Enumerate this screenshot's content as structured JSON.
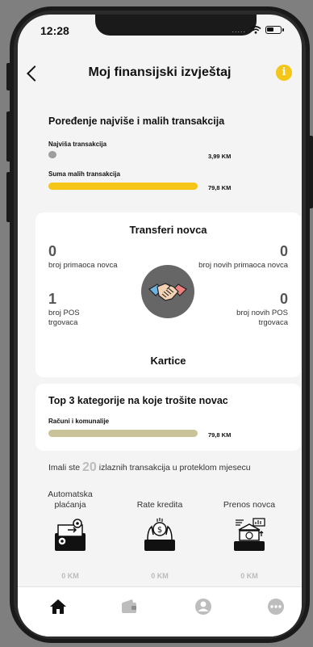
{
  "status_bar": {
    "time": "12:28",
    "dots": "....."
  },
  "header": {
    "title": "Moj finansijski izvještaj",
    "info_glyph": "i"
  },
  "comparison": {
    "title": "Poređenje najviše i malih transakcija",
    "highest": {
      "label": "Najviša transakcija",
      "value": "3,99 KM",
      "fraction": 0.05,
      "color": "#9e9e9e"
    },
    "small_sum": {
      "label": "Suma malih transakcija",
      "value": "79,8 KM",
      "fraction": 1.0,
      "color": "#f5c518"
    }
  },
  "transfers": {
    "title": "Transferi novca",
    "recipients": {
      "value": "0",
      "label": "broj primaoca novca"
    },
    "new_recipients": {
      "value": "0",
      "label": "broj novih primaoca novca"
    },
    "pos": {
      "value": "1",
      "label": "broj POS trgovaca"
    },
    "new_pos": {
      "value": "0",
      "label": "broj novih POS trgovaca"
    },
    "icon": "handshake-icon",
    "cards_title": "Kartice"
  },
  "top3": {
    "title": "Top 3 kategorije na koje trošite novac",
    "items": [
      {
        "label": "Računi i komunalije",
        "value": "79,8 KM",
        "fraction": 1.0,
        "color": "#c9c39a"
      }
    ]
  },
  "outgoing": {
    "prefix": "Imali ste",
    "count": "20",
    "suffix": "izlaznih transakcija u proteklom mjesecu"
  },
  "categories": [
    {
      "title": "Automatska plaćanja",
      "amount": "0 KM",
      "icon": "automatic-payments-icon"
    },
    {
      "title": "Rate kredita",
      "amount": "0 KM",
      "icon": "loan-installments-icon"
    },
    {
      "title": "Prenos novca",
      "amount": "0 KM",
      "icon": "money-transfer-icon"
    }
  ],
  "nav": [
    {
      "name": "home",
      "icon": "home-icon",
      "active": true
    },
    {
      "name": "wallet",
      "icon": "wallet-icon",
      "active": false
    },
    {
      "name": "profile",
      "icon": "profile-icon",
      "active": false
    },
    {
      "name": "more",
      "icon": "more-icon",
      "active": false
    }
  ],
  "colors": {
    "accent": "#f5c518",
    "background": "#f4f4f4",
    "card": "#ffffff"
  }
}
